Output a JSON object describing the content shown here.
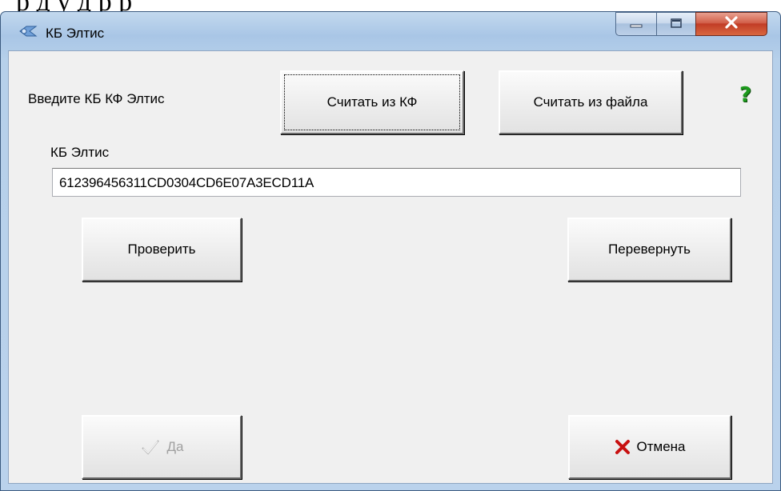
{
  "window": {
    "title": "КБ Элтис"
  },
  "header": {
    "prompt_label": "Введите КБ КФ Элтис",
    "read_from_kf_label": "Считать из КФ",
    "read_from_file_label": "Считать из файла",
    "help_glyph": "?"
  },
  "field": {
    "label": "КБ Элтис",
    "value": "612396456311CD0304CD6E07A3ECD11A"
  },
  "actions": {
    "check_label": "Проверить",
    "reverse_label": "Перевернуть",
    "ok_label": "Да",
    "cancel_label": "Отмена"
  },
  "icons": {
    "app": "app-icon",
    "minimize": "minimize-icon",
    "maximize": "maximize-icon",
    "close": "close-icon",
    "help": "help-icon",
    "ok": "check-icon",
    "cancel": "cross-icon"
  },
  "colors": {
    "help": "#1c9a1c",
    "cancel_cross": "#c81010",
    "close_button": "#c13d26",
    "disabled_text": "#a0a0a0"
  }
}
